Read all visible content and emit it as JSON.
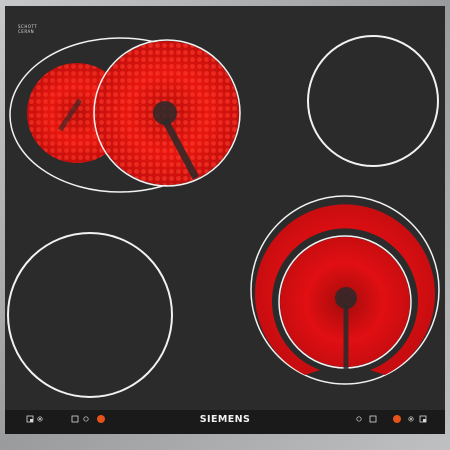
{
  "appliance": {
    "brand": "SIEMENS",
    "glass_mark": [
      "SCHOTT",
      "CERAN"
    ]
  },
  "zones": [
    {
      "id": "front-left-dual",
      "state": "on",
      "glow": "#e8170f"
    },
    {
      "id": "rear-right",
      "state": "off"
    },
    {
      "id": "front-left",
      "state": "off"
    },
    {
      "id": "front-right-extended",
      "state": "on",
      "glow": "#e10f12"
    }
  ],
  "controls": {
    "left": {
      "icons": [
        "zone-position-icon",
        "dual-zone-icon"
      ],
      "indicator": "on"
    },
    "right": {
      "icons": [
        "dual-zone-icon",
        "zone-position-icon"
      ],
      "indicator": "on"
    }
  },
  "colors": {
    "glass": "#2b2b2b",
    "frame": "#a8a9ab",
    "control_strip": "#1a1a1a",
    "indicator": "#e5531a",
    "ring": "#f2f2f2"
  }
}
